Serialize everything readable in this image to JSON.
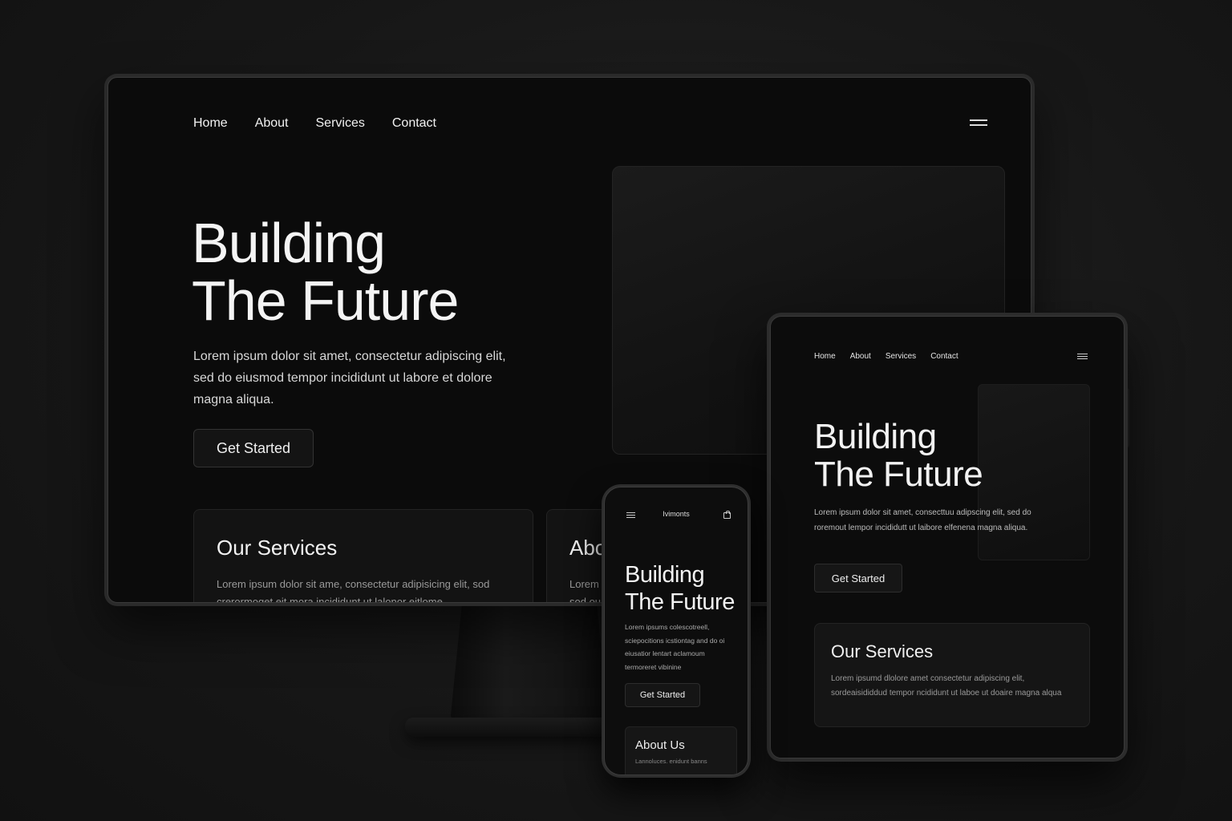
{
  "desktop": {
    "nav": [
      "Home",
      "About",
      "Services",
      "Contact"
    ],
    "heading_line1": "Building",
    "heading_line2": "The Future",
    "paragraph": "Lorem ipsum dolor sit amet, consectetur adipiscing elit, sed do eiusmod tempor incididunt ut labore et dolore magna aliqua.",
    "cta": "Get Started",
    "services_card": {
      "title": "Our Services",
      "text": "Lorem ipsum dolor sit ame, consectetur adipisicing elit, sod crerormoget eit mora incididunt ut lalonor eitlome"
    },
    "about_card": {
      "title": "Abo",
      "text": "Lorem",
      "text2": "sod ou"
    }
  },
  "tablet": {
    "nav": [
      "Home",
      "About",
      "Services",
      "Contact"
    ],
    "heading_line1": "Building",
    "heading_line2": "The Future",
    "paragraph": "Lorem ipsum dolor sit amet, consecttuu adipscing elit, sed do roremout lempor incididutt ut laibore elfenena magna aliqua.",
    "cta": "Get Started",
    "services_card": {
      "title": "Our Services",
      "text": "Lorem ipsumd dlolore amet consectetur adipiscing elit, sordeaisididdud tempor ncididunt ut laboe ut doaire magna alqua"
    }
  },
  "phone": {
    "brand": "Ivimonts",
    "heading_line1": "Building",
    "heading_line2": "The Future",
    "paragraph": "Lorem ipsums colescotreell, sciepocitions icstiontag and do oi eiusatior lentart aclamoum termoreret vibinine",
    "cta": "Get Started",
    "about_card": {
      "title": "About Us",
      "text": "Lannoluces. enidunt banns"
    }
  }
}
